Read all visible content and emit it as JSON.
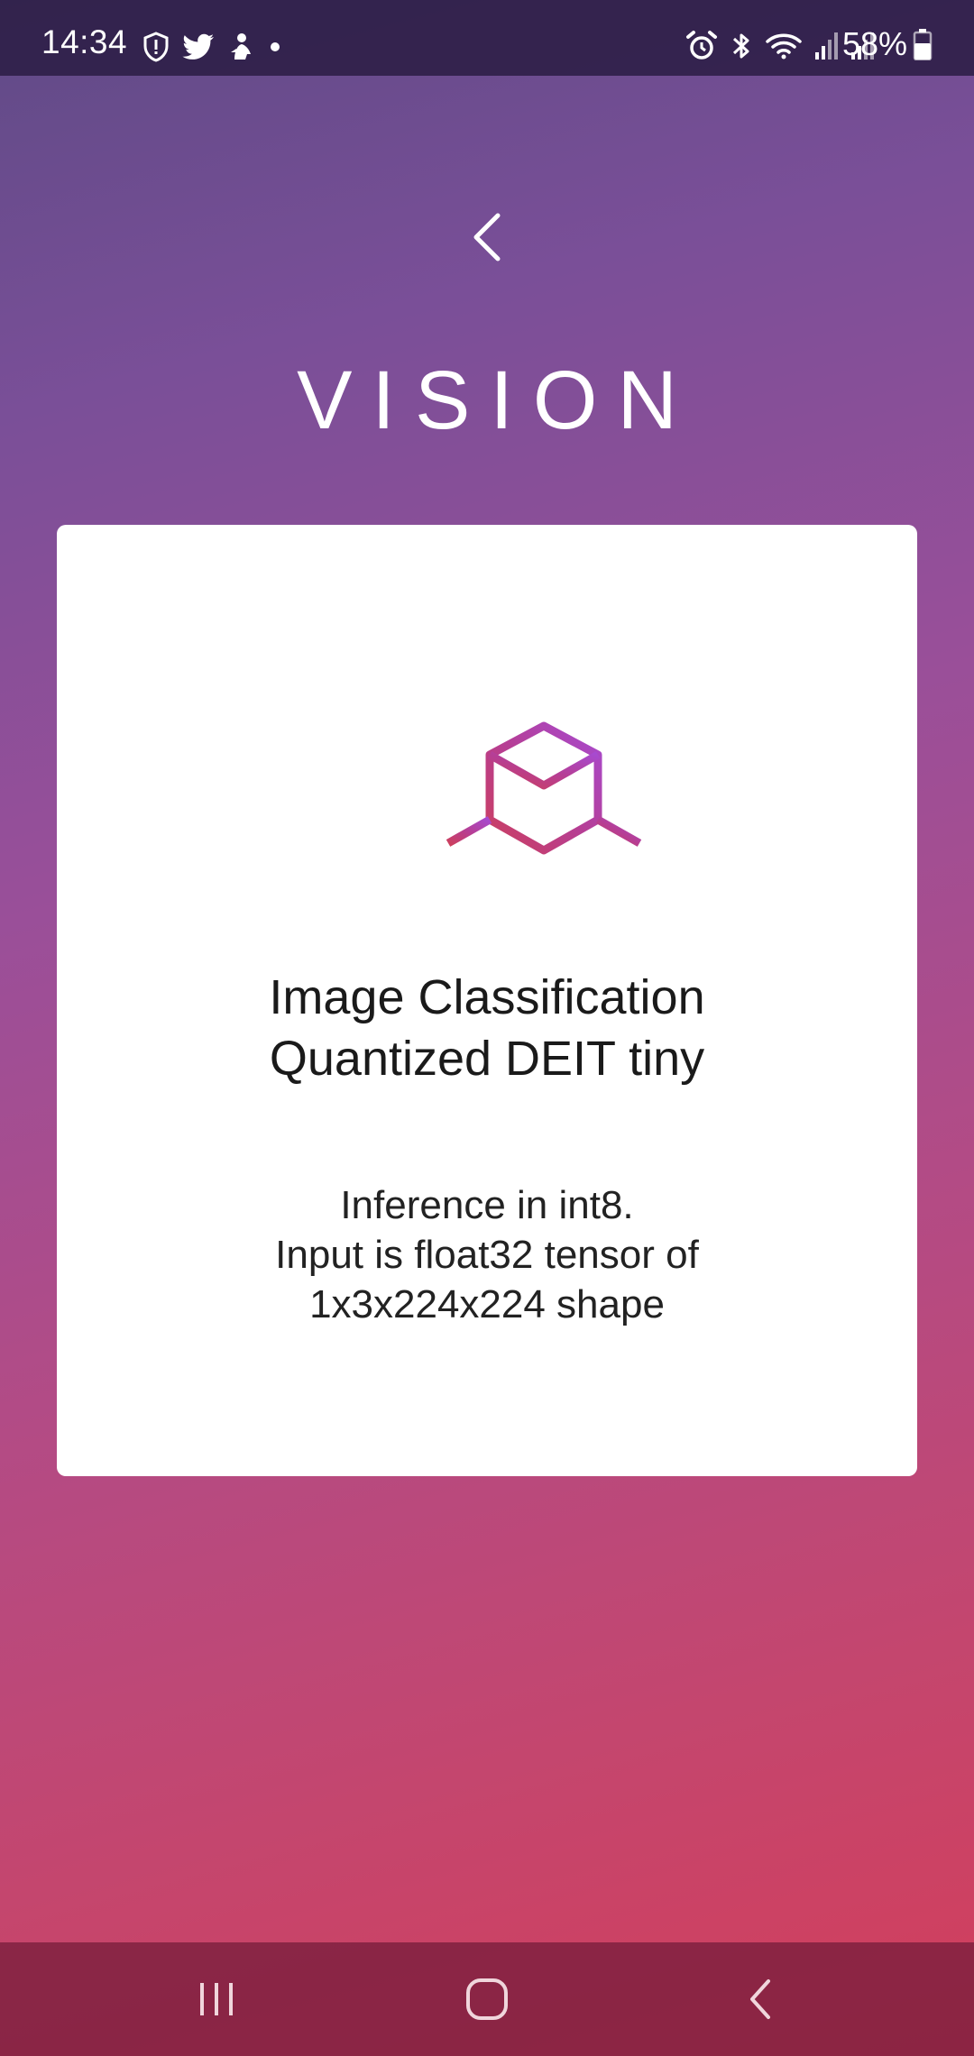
{
  "status_bar": {
    "time": "14:34",
    "battery": "58%",
    "left_icons": [
      "shield-alert-icon",
      "twitter-icon",
      "app-notification-icon",
      "dot-icon"
    ],
    "right_icons": [
      "alarm-icon",
      "bluetooth-icon",
      "wifi-icon",
      "signal-icon",
      "signal-icon"
    ]
  },
  "header": {
    "title": "VISION",
    "back_icon": "chevron-left-icon"
  },
  "card": {
    "icon": "cube-model-icon",
    "title_lines": [
      "Image Classification",
      "Quantized DEIT tiny"
    ],
    "description_lines": [
      "Inference in int8.",
      "Input is float32 tensor of",
      "1x3x224x224 shape"
    ],
    "accent_colors": [
      "#cc3f5e",
      "#b63e94",
      "#a74ad0"
    ]
  },
  "nav_bar": {
    "buttons": [
      "recent-apps-icon",
      "home-icon",
      "back-icon"
    ]
  }
}
